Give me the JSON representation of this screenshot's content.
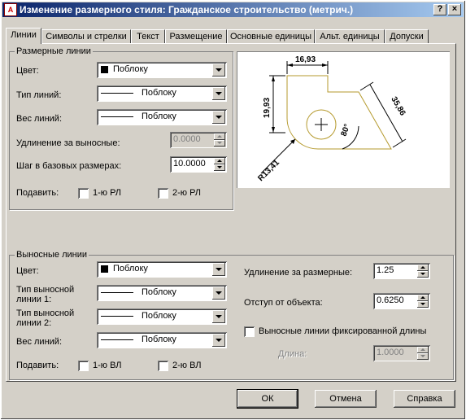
{
  "window": {
    "app_icon_text": "A",
    "title": "Изменение размерного стиля: Гражданское строительство (метрич.)",
    "help_label": "?",
    "close_label": "×"
  },
  "tabs": [
    {
      "label": "Линии",
      "active": true
    },
    {
      "label": "Символы и стрелки"
    },
    {
      "label": "Текст"
    },
    {
      "label": "Размещение"
    },
    {
      "label": "Основные единицы"
    },
    {
      "label": "Альт. единицы"
    },
    {
      "label": "Допуски"
    }
  ],
  "dim_lines": {
    "title": "Размерные линии",
    "color_label": "Цвет:",
    "color_value": "Поблоку",
    "linetype_label": "Тип линий:",
    "linetype_value": "Поблоку",
    "lineweight_label": "Вес линий:",
    "lineweight_value": "Поблоку",
    "extend_label": "Удлинение за выносные:",
    "extend_value": "0.0000",
    "baseline_label": "Шаг в базовых размерах:",
    "baseline_value": "10.0000",
    "suppress_label": "Подавить:",
    "suppress_1": "1-ю РЛ",
    "suppress_2": "2-ю РЛ"
  },
  "preview": {
    "dim_top": "16,93",
    "dim_left": "19,93",
    "dim_slant": "35,86",
    "angle": "80°",
    "radius": "R13,41"
  },
  "ext_lines": {
    "title": "Выносные линии",
    "color_label": "Цвет:",
    "color_value": "Поблоку",
    "linetype1_label_a": "Тип выносной",
    "linetype1_label_b": "линии 1:",
    "linetype1_value": "Поблоку",
    "linetype2_label_a": "Тип выносной",
    "linetype2_label_b": "линии 2:",
    "linetype2_value": "Поблоку",
    "lineweight_label": "Вес линий:",
    "lineweight_value": "Поблоку",
    "suppress_label": "Подавить:",
    "suppress_1": "1-ю ВЛ",
    "suppress_2": "2-ю ВЛ",
    "extend_label": "Удлинение за размерные:",
    "extend_value": "1.25",
    "offset_label": "Отступ от объекта:",
    "offset_value": "0.6250",
    "fixed_label": "Выносные линии фиксированной длины",
    "length_label": "Длина:",
    "length_value": "1.0000"
  },
  "buttons": {
    "ok": "ОК",
    "cancel": "Отмена",
    "help": "Справка"
  }
}
